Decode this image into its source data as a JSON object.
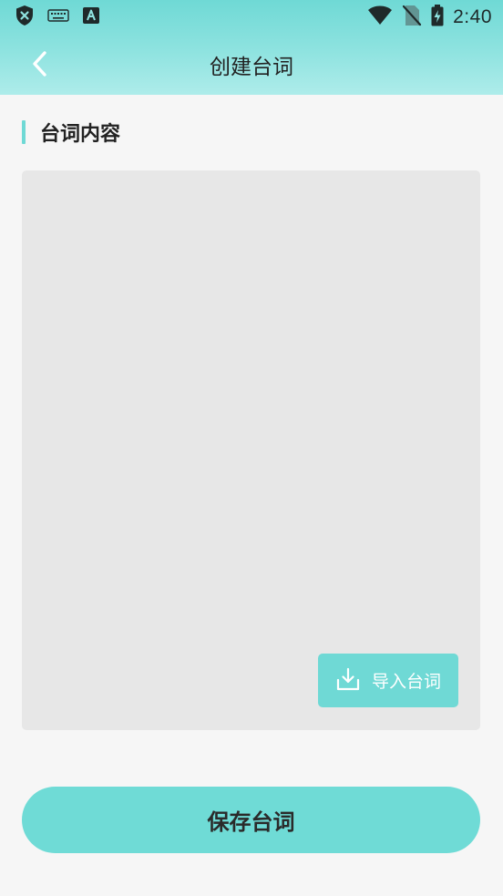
{
  "status_bar": {
    "time": "2:40",
    "left_icons": [
      "shield-x-icon",
      "keyboard-icon",
      "font-a-icon"
    ],
    "right_icons": [
      "wifi-icon",
      "no-sim-icon",
      "battery-charging-icon"
    ]
  },
  "nav": {
    "title": "创建台词",
    "back_icon": "chevron-left-icon"
  },
  "section": {
    "title": "台词内容"
  },
  "content": {
    "value": "",
    "placeholder": ""
  },
  "import_button": {
    "label": "导入台词",
    "icon": "download-icon"
  },
  "save_button": {
    "label": "保存台词"
  },
  "colors": {
    "accent": "#6fd9d5",
    "background": "#f6f6f6",
    "input_bg": "#e7e7e7"
  }
}
